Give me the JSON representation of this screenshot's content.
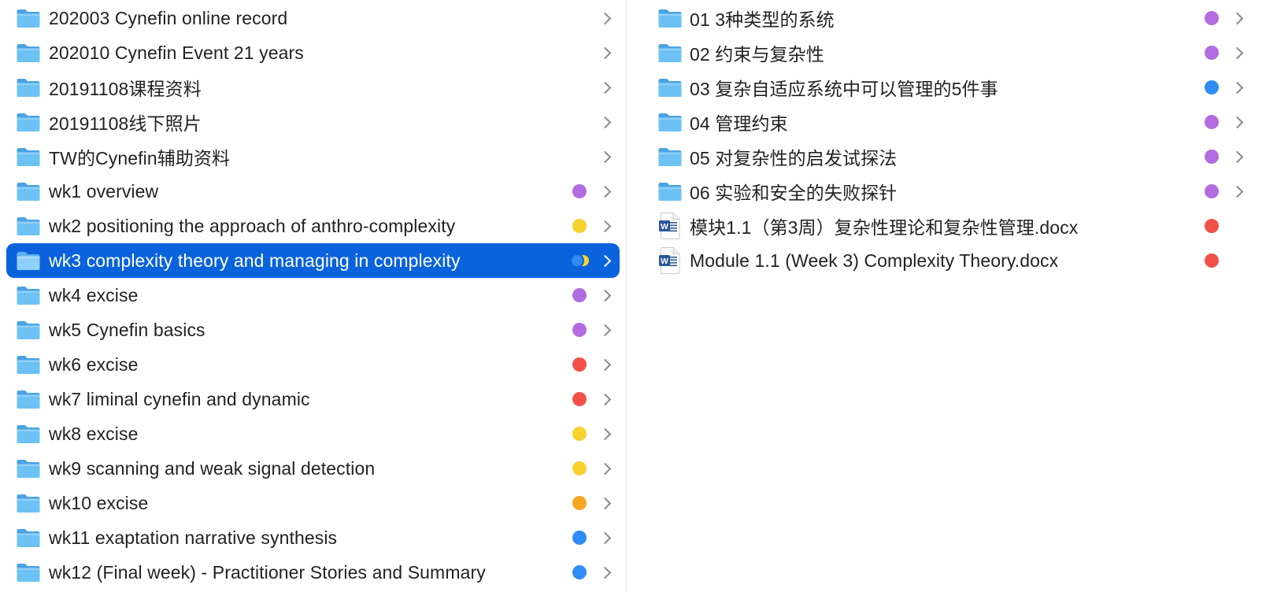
{
  "colors": {
    "purple": "#b36be0",
    "yellow": "#f7d22e",
    "red": "#f2514a",
    "orange": "#f5a623",
    "blue": "#2f8cf5",
    "selection": "#0a63dc"
  },
  "left_column": {
    "items": [
      {
        "name": "202003 Cynefin online record",
        "type": "folder",
        "tags": [],
        "has_chevron": true
      },
      {
        "name": "202010 Cynefin Event 21 years",
        "type": "folder",
        "tags": [],
        "has_chevron": true
      },
      {
        "name": "20191108课程资料",
        "type": "folder",
        "tags": [],
        "has_chevron": true
      },
      {
        "name": "20191108线下照片",
        "type": "folder",
        "tags": [],
        "has_chevron": true
      },
      {
        "name": "TW的Cynefin辅助资料",
        "type": "folder",
        "tags": [],
        "has_chevron": true
      },
      {
        "name": "wk1 overview",
        "type": "folder",
        "tags": [
          "purple"
        ],
        "has_chevron": true
      },
      {
        "name": "wk2 positioning the approach of anthro-complexity",
        "type": "folder",
        "tags": [
          "yellow"
        ],
        "has_chevron": true
      },
      {
        "name": "wk3 complexity theory and managing in complexity",
        "type": "folder",
        "tags": [
          "blue",
          "yellow"
        ],
        "has_chevron": true,
        "selected": true
      },
      {
        "name": "wk4 excise",
        "type": "folder",
        "tags": [
          "purple"
        ],
        "has_chevron": true
      },
      {
        "name": "wk5 Cynefin basics",
        "type": "folder",
        "tags": [
          "purple"
        ],
        "has_chevron": true
      },
      {
        "name": "wk6 excise",
        "type": "folder",
        "tags": [
          "red"
        ],
        "has_chevron": true
      },
      {
        "name": "wk7 liminal cynefin and dynamic",
        "type": "folder",
        "tags": [
          "red"
        ],
        "has_chevron": true
      },
      {
        "name": "wk8 excise",
        "type": "folder",
        "tags": [
          "yellow"
        ],
        "has_chevron": true
      },
      {
        "name": "wk9 scanning and weak signal detection",
        "type": "folder",
        "tags": [
          "yellow"
        ],
        "has_chevron": true
      },
      {
        "name": "wk10 excise",
        "type": "folder",
        "tags": [
          "orange"
        ],
        "has_chevron": true
      },
      {
        "name": "wk11 exaptation narrative synthesis",
        "type": "folder",
        "tags": [
          "blue"
        ],
        "has_chevron": true
      },
      {
        "name": "wk12 (Final week) - Practitioner Stories and Summary",
        "type": "folder",
        "tags": [
          "blue"
        ],
        "has_chevron": true
      }
    ]
  },
  "right_column": {
    "items": [
      {
        "name": "01 3种类型的系统",
        "type": "folder",
        "tags": [
          "purple"
        ],
        "has_chevron": true
      },
      {
        "name": "02 约束与复杂性",
        "type": "folder",
        "tags": [
          "purple"
        ],
        "has_chevron": true
      },
      {
        "name": "03 复杂自适应系统中可以管理的5件事",
        "type": "folder",
        "tags": [
          "blue"
        ],
        "has_chevron": true
      },
      {
        "name": "04 管理约束",
        "type": "folder",
        "tags": [
          "purple"
        ],
        "has_chevron": true
      },
      {
        "name": "05 对复杂性的启发试探法",
        "type": "folder",
        "tags": [
          "purple"
        ],
        "has_chevron": true
      },
      {
        "name": "06 实验和安全的失败探针",
        "type": "folder",
        "tags": [
          "purple"
        ],
        "has_chevron": true
      },
      {
        "name": "模块1.1（第3周）复杂性理论和复杂性管理.docx",
        "type": "word-doc",
        "tags": [
          "red"
        ],
        "has_chevron": false
      },
      {
        "name": "Module 1.1 (Week 3) Complexity Theory.docx",
        "type": "word-doc",
        "tags": [
          "red"
        ],
        "has_chevron": false
      }
    ]
  }
}
